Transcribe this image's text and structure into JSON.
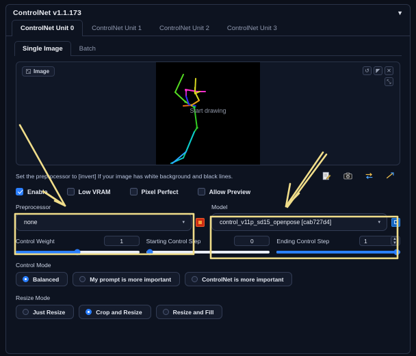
{
  "panel": {
    "title": "ControlNet v1.1.173",
    "collapse_icon": "chevron-down-icon"
  },
  "unit_tabs": [
    {
      "label": "ControlNet Unit 0",
      "active": true
    },
    {
      "label": "ControlNet Unit 1",
      "active": false
    },
    {
      "label": "ControlNet Unit 2",
      "active": false
    },
    {
      "label": "ControlNet Unit 3",
      "active": false
    }
  ],
  "sub_tabs": [
    {
      "label": "Single Image",
      "active": true
    },
    {
      "label": "Batch",
      "active": false
    }
  ],
  "image_area": {
    "chip_label": "Image",
    "chip_icon": "image-icon",
    "canvas_placeholder": "Start drawing",
    "tools": [
      {
        "name": "undo-icon",
        "glyph": "↺"
      },
      {
        "name": "eraser-icon",
        "glyph": "◤"
      },
      {
        "name": "close-icon",
        "glyph": "✕"
      },
      {
        "name": "expand-icon",
        "glyph": "⤡"
      }
    ]
  },
  "hint": {
    "text": "Set the preprocessor to [invert] If your image has white background and black lines.",
    "icons": [
      {
        "name": "edit-note-icon"
      },
      {
        "name": "camera-icon"
      },
      {
        "name": "swap-icon"
      },
      {
        "name": "send-icon"
      }
    ]
  },
  "checkboxes": [
    {
      "label": "Enable",
      "checked": true
    },
    {
      "label": "Low VRAM",
      "checked": false
    },
    {
      "label": "Pixel Perfect",
      "checked": false
    },
    {
      "label": "Allow Preview",
      "checked": false
    }
  ],
  "preprocessor": {
    "label": "Preprocessor",
    "value": "none",
    "caret": "▾",
    "action_icon": "run-preprocessor-icon"
  },
  "model": {
    "label": "Model",
    "value": "control_v11p_sd15_openpose [cab727d4]",
    "caret": "▾",
    "action_icon": "refresh-models-icon"
  },
  "sliders": [
    {
      "label": "Control Weight",
      "value": "1",
      "fill_pct": 50,
      "knob_pct": 50,
      "spinner": false
    },
    {
      "label": "Starting Control Step",
      "value": "0",
      "fill_pct": 0,
      "knob_pct": 2,
      "spinner": false
    },
    {
      "label": "Ending Control Step",
      "value": "1",
      "fill_pct": 100,
      "knob_pct": 98,
      "spinner": true
    }
  ],
  "control_mode": {
    "label": "Control Mode",
    "options": [
      {
        "label": "Balanced",
        "selected": true
      },
      {
        "label": "My prompt is more important",
        "selected": false
      },
      {
        "label": "ControlNet is more important",
        "selected": false
      }
    ]
  },
  "resize_mode": {
    "label": "Resize Mode",
    "options": [
      {
        "label": "Just Resize",
        "selected": false
      },
      {
        "label": "Crop and Resize",
        "selected": true
      },
      {
        "label": "Resize and Fill",
        "selected": false
      }
    ]
  },
  "colors": {
    "accent_blue": "#2b7fff",
    "panel_bg": "#0d1320",
    "border": "#2a3348",
    "annotation_yellow": "#f0dd8a",
    "orange_btn": "#cc2b12"
  },
  "annotations": {
    "arrow_left_target": "Preprocessor",
    "arrow_right_target": "Model",
    "box_left": "Preprocessor",
    "box_right": "Model"
  }
}
